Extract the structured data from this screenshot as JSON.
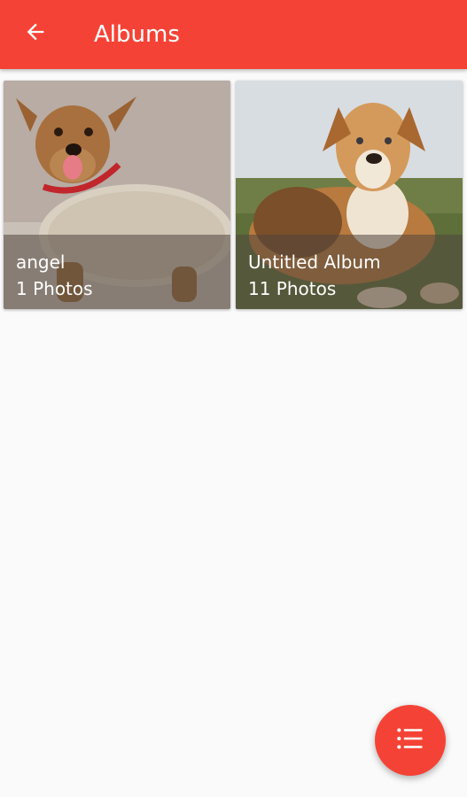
{
  "app_bar": {
    "title": "Albums",
    "back_icon": "arrow-back-icon",
    "color": "#f44336"
  },
  "albums": [
    {
      "name": "angel",
      "count": "1 Photos",
      "cover": "yorkshire-terrier-in-knit-sweater"
    },
    {
      "name": "Untitled Album",
      "count": "11 Photos",
      "cover": "golden-retriever-mix-lying-on-grass"
    }
  ],
  "fab": {
    "icon": "list-icon",
    "color": "#f44336"
  }
}
